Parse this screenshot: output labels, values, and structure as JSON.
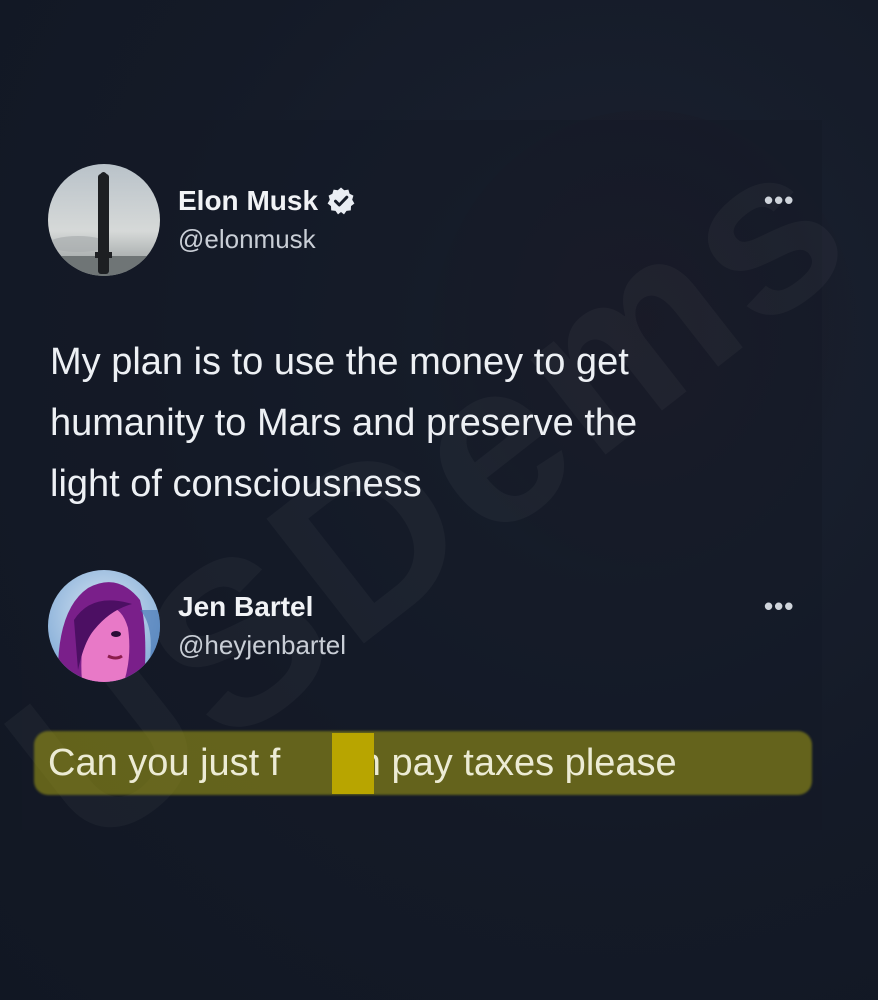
{
  "tweet": {
    "author_name": "Elon Musk",
    "author_handle": "@elonmusk",
    "verified_icon": "verified-badge-icon",
    "more_label": "•••",
    "text_lines": [
      "My plan is to use the money to get",
      "humanity to Mars and preserve the",
      "light of consciousness"
    ]
  },
  "reply": {
    "author_name": "Jen Bartel",
    "author_handle": "@heyjenbartel",
    "more_label": "•••",
    "text_before": "Can you just f",
    "text_after": "kin pay taxes please"
  },
  "watermark": {
    "text": "USDems"
  },
  "colors": {
    "background": "#151b28",
    "highlight": "#a5a014",
    "censor_block": "#b8a500",
    "verified": "#e9edf3"
  }
}
